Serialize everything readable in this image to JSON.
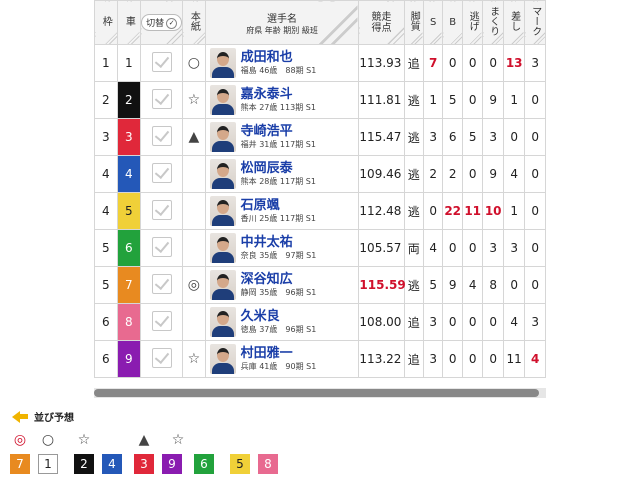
{
  "headers": {
    "waku": "枠",
    "sha": "車",
    "kiri": "切替",
    "hon": "本紙",
    "rider_title": "選手名",
    "rider_sub": "府県 年齢 期別 級班",
    "tok": "競走得点",
    "kyaku": "脚質",
    "s": "S",
    "b": "B",
    "nige": "逃げ",
    "makuri": "まくり",
    "sashi": "差し",
    "mark": "マーク"
  },
  "rows": [
    {
      "waku": "1",
      "car": "1",
      "car_bg": "#ffffff",
      "car_fg": "#222222",
      "hon": "○",
      "name": "成田和也",
      "sub": "福島 46歳　88期 S1",
      "tok": "113.93",
      "tok_red": false,
      "kyaku": "追",
      "s": "7",
      "s_red": true,
      "b": "0",
      "nige": "0",
      "makuri": "0",
      "sashi": "13",
      "sashi_red": true,
      "mark": "3",
      "mark_red": false
    },
    {
      "waku": "2",
      "car": "2",
      "car_bg": "#111111",
      "car_fg": "#ffffff",
      "hon": "☆",
      "name": "嘉永泰斗",
      "sub": "熊本 27歳 113期 S1",
      "tok": "111.81",
      "tok_red": false,
      "kyaku": "逃",
      "s": "1",
      "s_red": false,
      "b": "5",
      "nige": "0",
      "makuri": "9",
      "sashi": "1",
      "sashi_red": false,
      "mark": "0",
      "mark_red": false
    },
    {
      "waku": "3",
      "car": "3",
      "car_bg": "#e0283a",
      "car_fg": "#ffffff",
      "hon": "▲",
      "name": "寺崎浩平",
      "sub": "福井 31歳 117期 S1",
      "tok": "115.47",
      "tok_red": false,
      "kyaku": "逃",
      "s": "3",
      "s_red": false,
      "b": "6",
      "nige": "5",
      "makuri": "3",
      "sashi": "0",
      "sashi_red": false,
      "mark": "0",
      "mark_red": false
    },
    {
      "waku": "4",
      "car": "4",
      "car_bg": "#2458b8",
      "car_fg": "#ffffff",
      "hon": "",
      "name": "松岡辰泰",
      "sub": "熊本 28歳 117期 S1",
      "tok": "109.46",
      "tok_red": false,
      "kyaku": "逃",
      "s": "2",
      "s_red": false,
      "b": "2",
      "nige": "0",
      "makuri": "9",
      "sashi": "4",
      "sashi_red": false,
      "mark": "0",
      "mark_red": false
    },
    {
      "waku": "4",
      "car": "5",
      "car_bg": "#f0d038",
      "car_fg": "#222222",
      "hon": "",
      "name": "石原颯",
      "sub": "香川 25歳 117期 S1",
      "tok": "112.48",
      "tok_red": false,
      "kyaku": "逃",
      "s": "0",
      "s_red": false,
      "b": "22",
      "b_red": true,
      "nige": "11",
      "nige_red": true,
      "makuri": "10",
      "makuri_red": true,
      "sashi": "1",
      "sashi_red": false,
      "mark": "0",
      "mark_red": false
    },
    {
      "waku": "5",
      "car": "6",
      "car_bg": "#22a23c",
      "car_fg": "#ffffff",
      "hon": "",
      "name": "中井太祐",
      "sub": "奈良 35歳　97期 S1",
      "tok": "105.57",
      "tok_red": false,
      "kyaku": "両",
      "s": "4",
      "s_red": false,
      "b": "0",
      "nige": "0",
      "makuri": "3",
      "sashi": "3",
      "sashi_red": false,
      "mark": "0",
      "mark_red": false
    },
    {
      "waku": "5",
      "car": "7",
      "car_bg": "#e88a20",
      "car_fg": "#ffffff",
      "hon": "◎",
      "hon_red": true,
      "name": "深谷知広",
      "sub": "静岡 35歳　96期 S1",
      "tok": "115.59",
      "tok_red": true,
      "kyaku": "逃",
      "s": "5",
      "s_red": false,
      "b": "9",
      "nige": "4",
      "makuri": "8",
      "sashi": "0",
      "sashi_red": false,
      "mark": "0",
      "mark_red": false
    },
    {
      "waku": "6",
      "car": "8",
      "car_bg": "#e86a90",
      "car_fg": "#ffffff",
      "hon": "",
      "name": "久米良",
      "sub": "徳島 37歳　96期 S1",
      "tok": "108.00",
      "tok_red": false,
      "kyaku": "追",
      "s": "3",
      "s_red": false,
      "b": "0",
      "nige": "0",
      "makuri": "0",
      "sashi": "4",
      "sashi_red": false,
      "mark": "3",
      "mark_red": false
    },
    {
      "waku": "6",
      "car": "9",
      "car_bg": "#8a1cb0",
      "car_fg": "#ffffff",
      "hon": "☆",
      "name": "村田雅一",
      "sub": "兵庫 41歳　90期 S1",
      "tok": "113.22",
      "tok_red": false,
      "kyaku": "追",
      "s": "3",
      "s_red": false,
      "b": "0",
      "nige": "0",
      "makuri": "0",
      "sashi": "11",
      "sashi_red": false,
      "mark": "4",
      "mark_red": true
    }
  ],
  "prediction": {
    "title": "並び予想",
    "marks": [
      "◎",
      "○",
      "☆",
      "▲",
      "☆"
    ],
    "cars": [
      {
        "num": "7",
        "bg": "#e88a20",
        "fg": "#ffffff"
      },
      {
        "num": "1",
        "bg": "#ffffff",
        "fg": "#222222"
      },
      {
        "num": "2",
        "bg": "#111111",
        "fg": "#ffffff"
      },
      {
        "num": "4",
        "bg": "#2458b8",
        "fg": "#ffffff"
      },
      {
        "num": "3",
        "bg": "#e0283a",
        "fg": "#ffffff"
      },
      {
        "num": "9",
        "bg": "#8a1cb0",
        "fg": "#ffffff"
      },
      {
        "num": "6",
        "bg": "#22a23c",
        "fg": "#ffffff"
      },
      {
        "num": "5",
        "bg": "#f0d038",
        "fg": "#222222"
      },
      {
        "num": "8",
        "bg": "#e86a90",
        "fg": "#ffffff"
      }
    ]
  }
}
